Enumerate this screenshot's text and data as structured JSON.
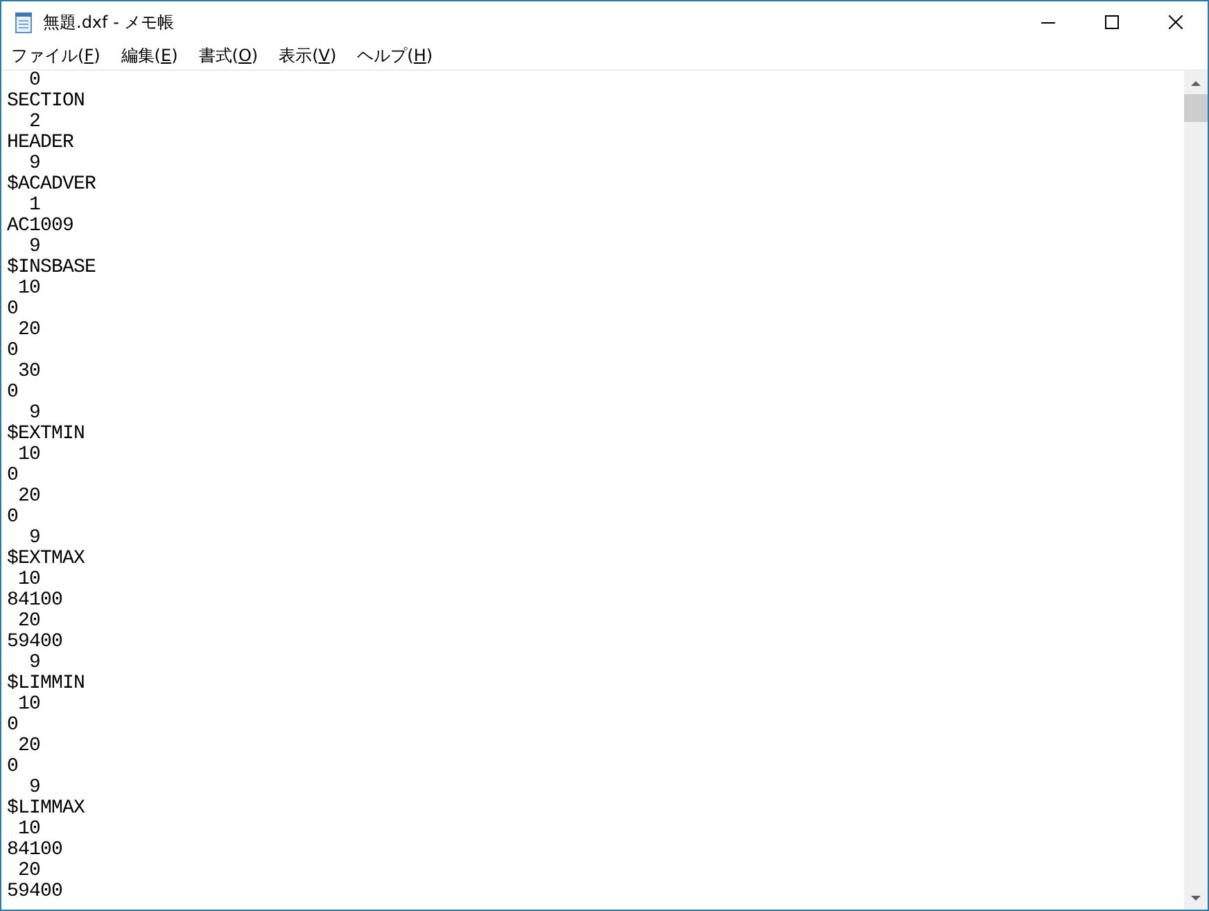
{
  "window": {
    "title": "無題.dxf - メモ帳"
  },
  "menu_bar": {
    "items": [
      "ファイル(F)",
      "編集(E)",
      "書式(O)",
      "表示(V)",
      "ヘルプ(H)"
    ]
  },
  "editor": {
    "lines": [
      "  0",
      "SECTION",
      "  2",
      "HEADER",
      "  9",
      "$ACADVER",
      "  1",
      "AC1009",
      "  9",
      "$INSBASE",
      " 10",
      "0",
      " 20",
      "0",
      " 30",
      "0",
      "  9",
      "$EXTMIN",
      " 10",
      "0",
      " 20",
      "0",
      "  9",
      "$EXTMAX",
      " 10",
      "84100",
      " 20",
      "59400",
      "  9",
      "$LIMMIN",
      " 10",
      "0",
      " 20",
      "0",
      "  9",
      "$LIMMAX",
      " 10",
      "84100",
      " 20",
      "59400"
    ]
  }
}
